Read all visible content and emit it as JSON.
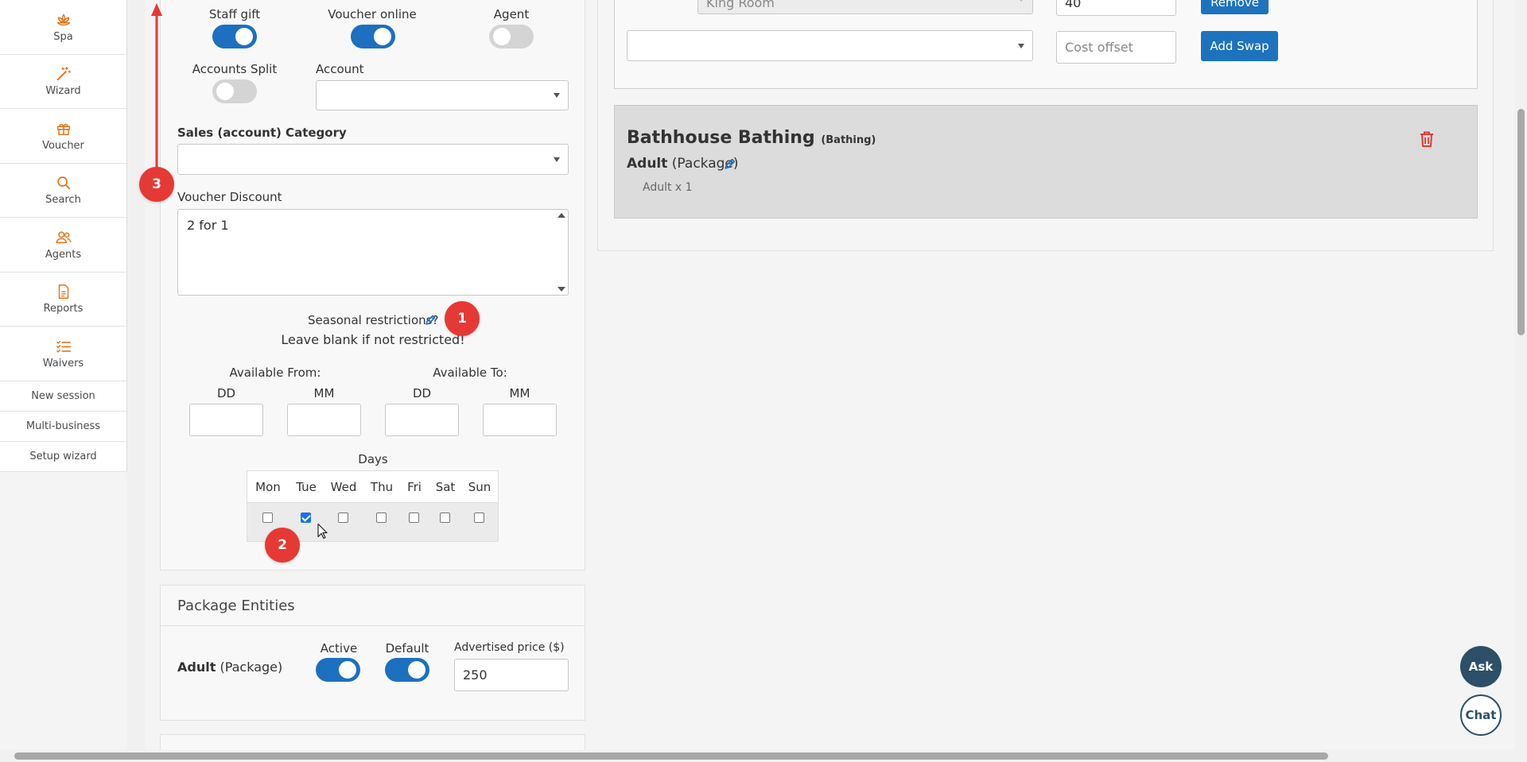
{
  "sidebar": {
    "items": [
      {
        "label": "Spa",
        "icon": "lotus-icon"
      },
      {
        "label": "Wizard",
        "icon": "magic-wand-icon"
      },
      {
        "label": "Voucher",
        "icon": "gift-icon"
      },
      {
        "label": "Search",
        "icon": "search-icon"
      },
      {
        "label": "Agents",
        "icon": "users-icon"
      },
      {
        "label": "Reports",
        "icon": "document-icon"
      },
      {
        "label": "Waivers",
        "icon": "checklist-icon"
      }
    ],
    "links": [
      "New session",
      "Multi-business",
      "Setup wizard"
    ]
  },
  "settings": {
    "staff_gift_label": "Staff gift",
    "staff_gift_on": true,
    "voucher_online_label": "Voucher online",
    "voucher_online_on": true,
    "agent_label": "Agent",
    "agent_on": false,
    "accounts_split_label": "Accounts Split",
    "accounts_split_on": false,
    "account_label": "Account",
    "account_value": "",
    "sales_category_label": "Sales (account) Category",
    "sales_category_value": "",
    "voucher_discount_label": "Voucher Discount",
    "voucher_discount_value": "2 for 1",
    "seasonal_label": "Seasonal restrictions?",
    "seasonal_hint": "Leave blank if not restricted!",
    "available_from_label": "Available From:",
    "available_to_label": "Available To:",
    "dd_label": "DD",
    "mm_label": "MM",
    "from_dd": "",
    "from_mm": "",
    "to_dd": "",
    "to_mm": "",
    "days_label": "Days",
    "days": [
      {
        "name": "Mon",
        "checked": false
      },
      {
        "name": "Tue",
        "checked": true
      },
      {
        "name": "Wed",
        "checked": false
      },
      {
        "name": "Thu",
        "checked": false
      },
      {
        "name": "Fri",
        "checked": false
      },
      {
        "name": "Sat",
        "checked": false
      },
      {
        "name": "Sun",
        "checked": false
      }
    ]
  },
  "annotations": [
    "1",
    "2",
    "3"
  ],
  "entities": {
    "title": "Package Entities",
    "name": "Adult",
    "type": "(Package)",
    "active_label": "Active",
    "active_on": true,
    "default_label": "Default",
    "default_on": true,
    "price_label": "Advertised price ($)",
    "price_value": "250"
  },
  "swaps": {
    "existing_room": "King Room",
    "existing_cost": "40",
    "remove_label": "Remove",
    "new_select_value": "",
    "cost_placeholder": "Cost offset",
    "add_swap_label": "Add Swap"
  },
  "bathhouse": {
    "title": "Bathhouse Bathing",
    "category": "(Bathing)",
    "entity_name": "Adult",
    "entity_type": "(Package)",
    "line": "Adult x 1"
  },
  "fabs": {
    "ask": "Ask",
    "chat": "Chat"
  },
  "colors": {
    "accent": "#1e73be",
    "orange": "#e8731c",
    "danger": "#e53935"
  }
}
